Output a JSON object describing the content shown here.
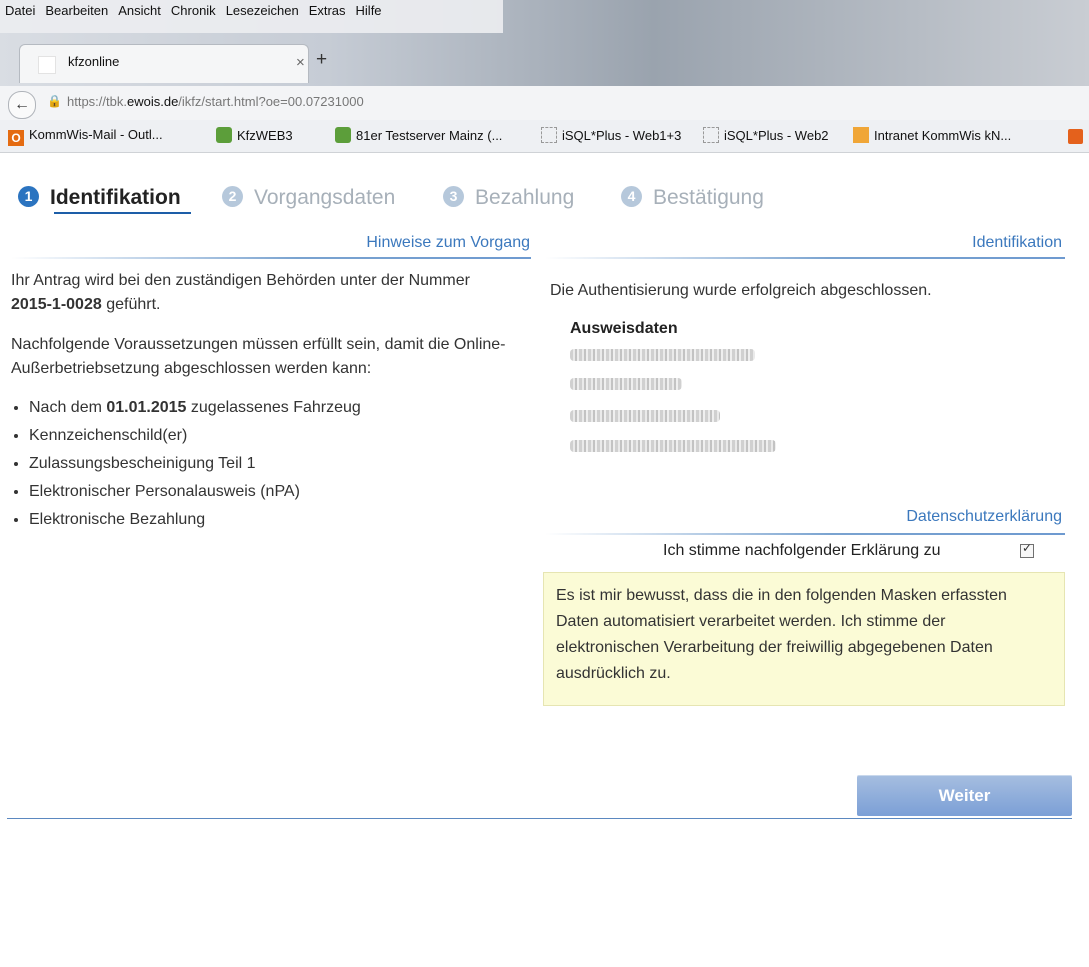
{
  "menu": [
    "Datei",
    "Bearbeiten",
    "Ansicht",
    "Chronik",
    "Lesezeichen",
    "Extras",
    "Hilfe"
  ],
  "tab": {
    "title": "kfzonline",
    "close": "×",
    "new": "+"
  },
  "address": {
    "prefix": "https://tbk.",
    "domain": "ewois.de",
    "path": "/ikfz/start.html?oe=00.07231000"
  },
  "bookmarks": [
    "KommWis-Mail - Outl...",
    "KfzWEB3",
    "81er Testserver Mainz (...",
    "iSQL*Plus - Web1+3",
    "iSQL*Plus - Web2",
    "Intranet KommWis kN..."
  ],
  "steps": [
    {
      "num": "1",
      "label": "Identifikation",
      "active": true
    },
    {
      "num": "2",
      "label": "Vorgangsdaten",
      "active": false
    },
    {
      "num": "3",
      "label": "Bezahlung",
      "active": false
    },
    {
      "num": "4",
      "label": "Bestätigung",
      "active": false
    }
  ],
  "sections": {
    "hinweise": "Hinweise zum Vorgang",
    "identifikation": "Identifikation",
    "datenschutz": "Datenschutzerklärung"
  },
  "left": {
    "antrag_pre": "Ihr Antrag wird bei den zuständigen Behörden unter der Nummer ",
    "antrag_nummer": "2015-1-0028",
    "antrag_post": " geführt.",
    "voraussetzungen": "Nachfolgende Voraussetzungen müssen erfüllt sein, damit die Online-Außerbetriebsetzung abgeschlossen werden kann:",
    "list_first_pre": "Nach dem ",
    "list_first_date": "01.01.2015",
    "list_first_post": " zugelassenes Fahrzeug",
    "list": [
      "Kennzeichenschild(er)",
      "Zulassungsbescheinigung Teil 1",
      "Elektronischer Personalausweis (nPA)",
      "Elektronische Bezahlung"
    ]
  },
  "right": {
    "auth_text": "Die Authentisierung wurde erfolgreich abgeschlossen.",
    "ausweis_title": "Ausweisdaten",
    "consent_label": "Ich stimme nachfolgender Erklärung zu",
    "consent_checked": true,
    "notice": "Es ist mir bewusst, dass die in den folgenden Masken erfassten Daten automatisiert verarbeitet werden. Ich stimme der elektronischen Verarbeitung der freiwillig abgegebenen Daten ausdrücklich zu."
  },
  "button": {
    "weiter": "Weiter"
  }
}
